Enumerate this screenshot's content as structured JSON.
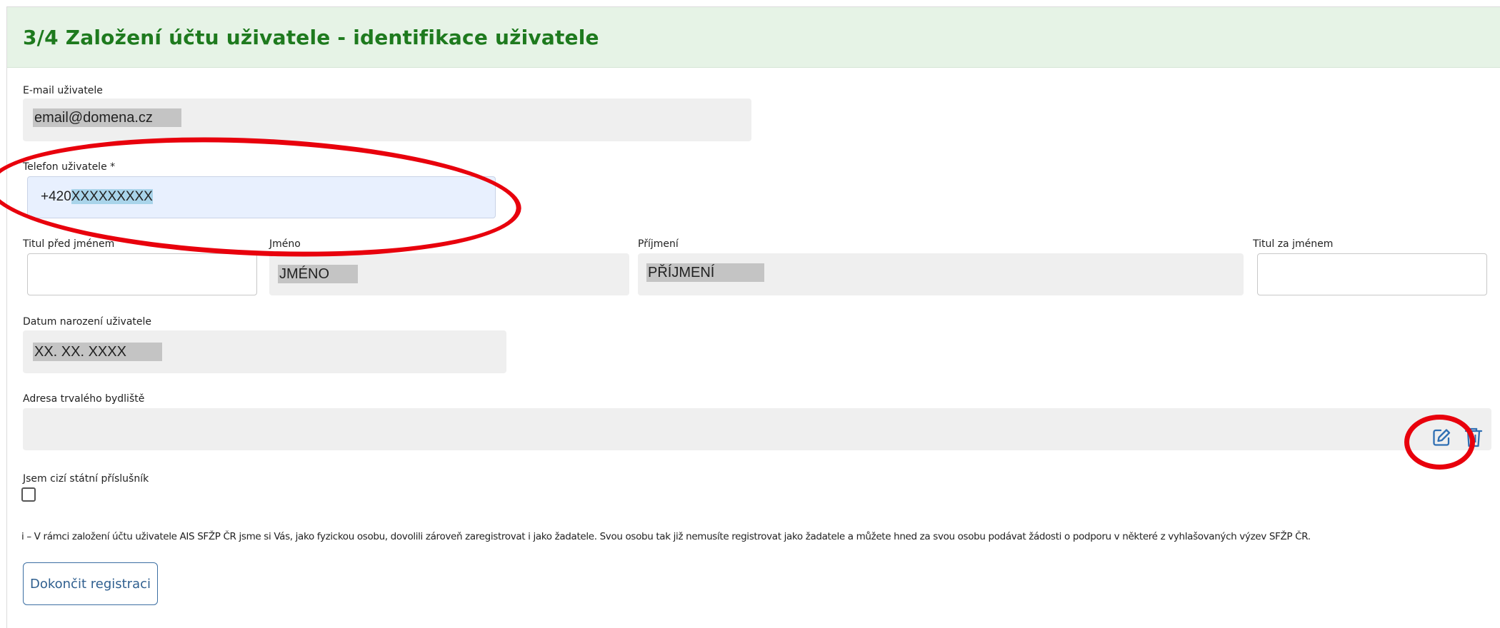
{
  "header": {
    "title": "3/4 Založení účtu uživatele - identifikace uživatele"
  },
  "email": {
    "label": "E-mail uživatele",
    "value": "email@domena.cz"
  },
  "phone": {
    "label": "Telefon uživatele *",
    "prefix": "+420",
    "value": "XXXXXXXXX"
  },
  "title_before": {
    "label": "Titul před jménem",
    "value": ""
  },
  "first_name": {
    "label": "Jméno",
    "value": "JMÉNO"
  },
  "last_name": {
    "label": "Příjmení",
    "value": "PŘÍJMENÍ"
  },
  "title_after": {
    "label": "Titul za jménem",
    "value": ""
  },
  "birth_date": {
    "label": "Datum narození uživatele",
    "value": "XX. XX. XXXX"
  },
  "address": {
    "label": "Adresa trvalého bydliště",
    "value": ""
  },
  "foreigner": {
    "label": "Jsem cizí státní příslušník",
    "checked": false
  },
  "info_text": "i – V rámci založení účtu uživatele AIS SFŽP ČR jsme si Vás, jako fyzickou osobu, dovolili zároveň zaregistrovat i jako žadatele. Svou osobu tak již nemusíte registrovat jako žadatele a můžete hned za svou osobu podávat žádosti o podporu v některé z vyhlašovaných výzev SFŽP ČR.",
  "submit_button": "Dokončit registraci",
  "icons": {
    "edit": "edit-icon",
    "delete": "trash-icon"
  },
  "colors": {
    "header_bg": "#e6f3e6",
    "header_text": "#1e7a1e",
    "annotation": "#e8000c",
    "button": "#2f5f8f"
  }
}
